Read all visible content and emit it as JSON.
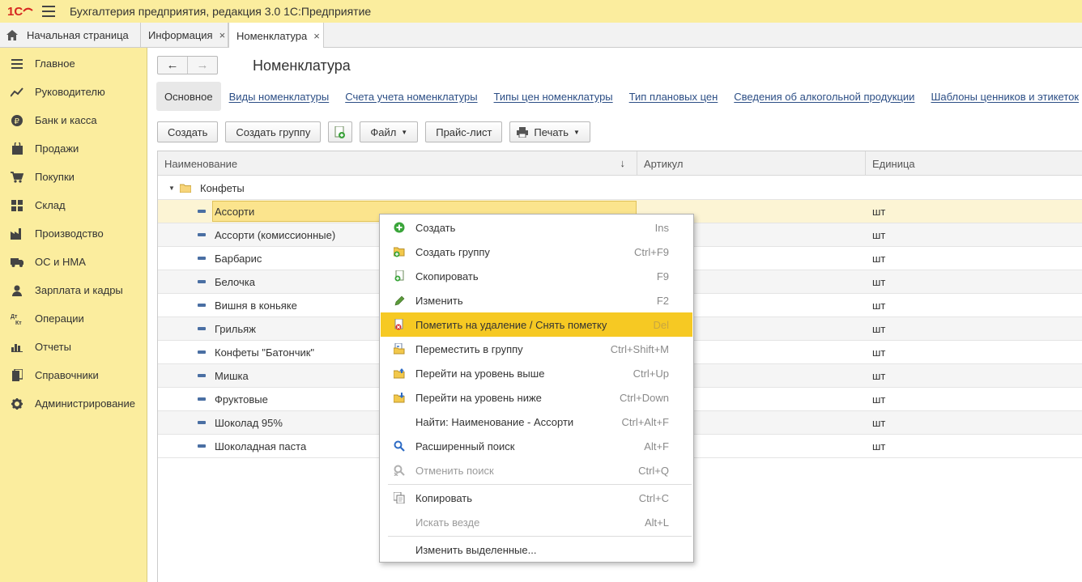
{
  "app": {
    "title": "Бухгалтерия предприятия, редакция 3.0 1С:Предприятие",
    "logo_text": "1С"
  },
  "tabs": [
    {
      "label": "Начальная страница"
    },
    {
      "label": "Информация",
      "close": "×"
    },
    {
      "label": "Номенклатура",
      "close": "×"
    }
  ],
  "sidebar": {
    "items": [
      {
        "label": "Главное",
        "icon": "menu-lines-icon"
      },
      {
        "label": "Руководителю",
        "icon": "trend-icon"
      },
      {
        "label": "Банк и касса",
        "icon": "ruble-coin-icon"
      },
      {
        "label": "Продажи",
        "icon": "shopping-bag-icon"
      },
      {
        "label": "Покупки",
        "icon": "cart-icon"
      },
      {
        "label": "Склад",
        "icon": "warehouse-grid-icon"
      },
      {
        "label": "Производство",
        "icon": "factory-icon"
      },
      {
        "label": "ОС и НМА",
        "icon": "truck-icon"
      },
      {
        "label": "Зарплата и кадры",
        "icon": "person-icon"
      },
      {
        "label": "Операции",
        "icon": "dt-kt-icon",
        "icon_text": "Дт Кт"
      },
      {
        "label": "Отчеты",
        "icon": "bar-chart-icon"
      },
      {
        "label": "Справочники",
        "icon": "books-icon"
      },
      {
        "label": "Администрирование",
        "icon": "gear-icon"
      }
    ]
  },
  "page": {
    "title": "Номенклатура",
    "back": "←",
    "forward": "→"
  },
  "links": {
    "main": "Основное",
    "items": [
      "Виды номенклатуры",
      "Счета учета номенклатуры",
      "Типы цен номенклатуры",
      "Тип плановых цен",
      "Сведения об алкогольной продукции",
      "Шаблоны ценников и этикеток"
    ]
  },
  "toolbar": {
    "create": "Создать",
    "create_group": "Создать группу",
    "file": "Файл",
    "price_list": "Прайс-лист",
    "print": "Печать"
  },
  "grid": {
    "columns": [
      "Наименование",
      "Артикул",
      "Единица"
    ],
    "sort_indicator": "↓",
    "group": "Конфеты",
    "rows": [
      {
        "name": "Ассорти",
        "article": "",
        "unit": "шт"
      },
      {
        "name": "Ассорти (комиссионные)",
        "article": "",
        "unit": "шт"
      },
      {
        "name": "Барбарис",
        "article": "",
        "unit": "шт"
      },
      {
        "name": "Белочка",
        "article": "",
        "unit": "шт"
      },
      {
        "name": "Вишня в коньяке",
        "article": "",
        "unit": "шт"
      },
      {
        "name": "Грильяж",
        "article": "",
        "unit": "шт"
      },
      {
        "name": "Конфеты \"Батончик\"",
        "article": "",
        "unit": "шт"
      },
      {
        "name": "Мишка",
        "article": "",
        "unit": "шт"
      },
      {
        "name": "Фруктовые",
        "article": "",
        "unit": "шт"
      },
      {
        "name": "Шоколад 95%",
        "article": "",
        "unit": "шт"
      },
      {
        "name": "Шоколадная паста",
        "article": "",
        "unit": "шт"
      }
    ]
  },
  "context_menu": {
    "items": [
      {
        "label": "Создать",
        "shortcut": "Ins",
        "icon": "plus-circle-icon"
      },
      {
        "label": "Создать группу",
        "shortcut": "Ctrl+F9",
        "icon": "folder-plus-icon"
      },
      {
        "label": "Скопировать",
        "shortcut": "F9",
        "icon": "copy-doc-icon"
      },
      {
        "label": "Изменить",
        "shortcut": "F2",
        "icon": "pencil-icon"
      },
      {
        "label": "Пометить на удаление / Снять пометку",
        "shortcut": "Del",
        "icon": "delete-mark-icon"
      },
      {
        "label": "Переместить в группу",
        "shortcut": "Ctrl+Shift+M",
        "icon": "move-to-group-icon"
      },
      {
        "label": "Перейти на уровень выше",
        "shortcut": "Ctrl+Up",
        "icon": "folder-up-icon"
      },
      {
        "label": "Перейти на уровень ниже",
        "shortcut": "Ctrl+Down",
        "icon": "folder-down-icon"
      },
      {
        "label": "Найти: Наименование - Ассорти",
        "shortcut": "Ctrl+Alt+F",
        "icon": ""
      },
      {
        "label": "Расширенный поиск",
        "shortcut": "Alt+F",
        "icon": "search-icon"
      },
      {
        "label": "Отменить поиск",
        "shortcut": "Ctrl+Q",
        "icon": "cancel-search-icon"
      },
      {
        "label": "Копировать",
        "shortcut": "Ctrl+C",
        "icon": "copy-icon"
      },
      {
        "label": "Искать везде",
        "shortcut": "Alt+L",
        "icon": ""
      },
      {
        "label": "Изменить выделенные...",
        "shortcut": "",
        "icon": ""
      }
    ]
  },
  "colors": {
    "panel_yellow": "#fbed9e",
    "highlight": "#f6c923",
    "link_blue": "#2c4e85",
    "selected_row": "#fbe48d"
  }
}
